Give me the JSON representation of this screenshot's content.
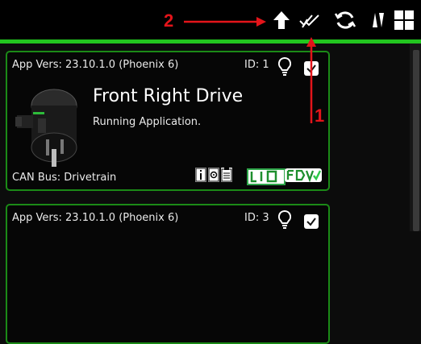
{
  "toolbar": {
    "icons": [
      "upload-arrow-icon",
      "double-check-icon",
      "refresh-icon",
      "sort-icon",
      "grid-view-icon"
    ]
  },
  "annotations": {
    "label_1": "1",
    "label_2": "2",
    "color": "#e3141a"
  },
  "colors": {
    "accent": "#22c51f",
    "card_border": "#1b8a17",
    "background": "#0c0c0c"
  },
  "cards": [
    {
      "app_vers": "App Vers: 23.10.1.0 (Phoenix 6)",
      "id": "ID: 1",
      "name": "Front Right Drive",
      "status": "Running Application.",
      "can_bus": "CAN Bus: Drivetrain",
      "checked": true
    },
    {
      "app_vers": "App Vers: 23.10.1.0 (Phoenix 6)",
      "id": "ID: 3",
      "checked": true
    }
  ]
}
